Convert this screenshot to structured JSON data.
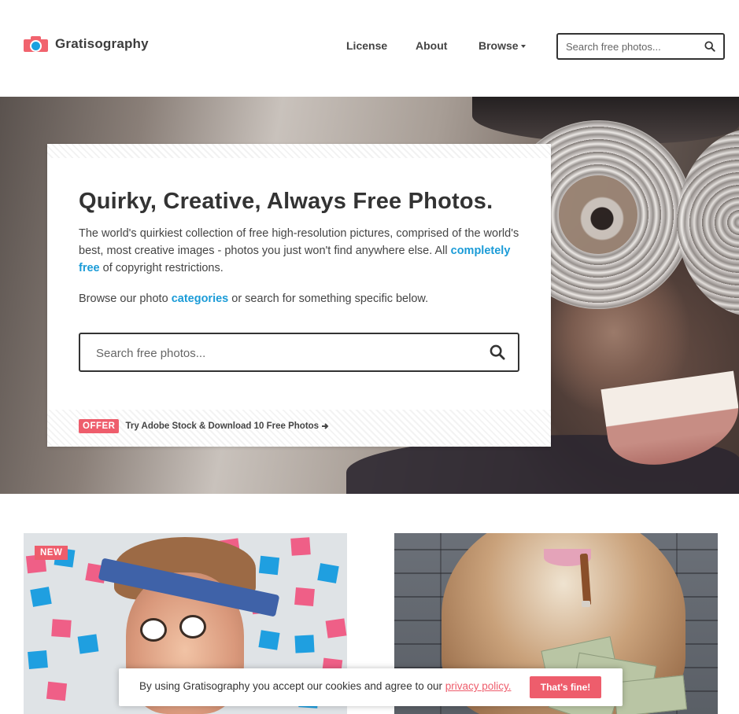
{
  "header": {
    "brand": "Gratisography",
    "nav": {
      "license": "License",
      "about": "About",
      "browse": "Browse"
    },
    "search_placeholder": "Search free photos..."
  },
  "hero": {
    "title": "Quirky, Creative, Always Free Photos.",
    "desc_before": "The world's quirkiest collection of free high-resolution pictures, comprised of the world's best, most creative images - photos you just won't find anywhere else. All ",
    "desc_link": "completely free",
    "desc_after": " of copyright restrictions.",
    "browse_before": "Browse our photo ",
    "browse_link": "categories",
    "browse_after": " or search for something specific below.",
    "search_placeholder": "Search free photos...",
    "offer_badge": "OFFER",
    "offer_text": "Try Adobe Stock & Download 10 Free Photos"
  },
  "photos": {
    "left_badge": "NEW"
  },
  "cookie": {
    "text_before": "By using Gratisography you accept our cookies and agree to our ",
    "link": "privacy policy.",
    "button": "That's fine!"
  },
  "colors": {
    "accent_pink": "#ee5d6c",
    "link_blue": "#1a9bd7",
    "text_dark": "#333333"
  },
  "icons": {
    "logo": "camera-icon",
    "search": "search-icon",
    "browse_caret": "caret-down-icon",
    "offer_arrow": "arrow-right-icon"
  }
}
